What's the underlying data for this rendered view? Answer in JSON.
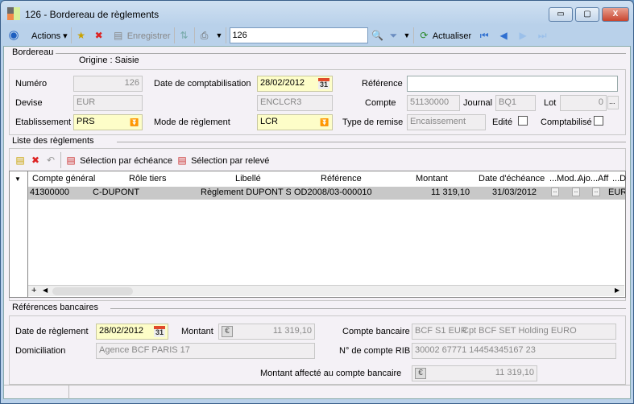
{
  "window": {
    "title": "126 -  Bordereau de règlements",
    "minimize": "▭",
    "maximize": "▢",
    "close": "X"
  },
  "toolbar": {
    "actions": "Actions",
    "save": "Enregistrer",
    "search_value": "126",
    "refresh": "Actualiser"
  },
  "bordereau": {
    "section": "Bordereau",
    "origine": "Origine : Saisie",
    "numero_label": "Numéro",
    "numero": "126",
    "date_compta_label": "Date de comptabilisation",
    "date_compta": "28/02/2012",
    "reference_label": "Référence",
    "reference": "",
    "devise_label": "Devise",
    "devise": "EUR",
    "code": "ENCLCR3",
    "compte_label": "Compte",
    "compte": "51130000",
    "journal_label": "Journal",
    "journal": "BQ1",
    "lot_label": "Lot",
    "lot": "0",
    "etab_label": "Etablissement",
    "etab": "PRS",
    "mode_label": "Mode de règlement",
    "mode": "LCR",
    "type_remise_label": "Type de remise",
    "type_remise": "Encaissement",
    "edite_label": "Edité",
    "compta_label": "Comptabilisé"
  },
  "liste": {
    "section": "Liste des règlements",
    "sel_echeance": "Sélection par échéance",
    "sel_releve": "Sélection par relevé",
    "columns": [
      "Compte général",
      "Rôle tiers",
      "Libellé",
      "Référence",
      "Montant",
      "Date d'échéance",
      "...Mod...",
      "Ajo...",
      "Aff",
      "...D"
    ],
    "rows": [
      {
        "compte": "41300000",
        "role": "C-DUPONT",
        "libelle": "Règlement DUPONT SA",
        "reference": "OD2008/03-000010",
        "montant": "11 319,10",
        "date": "31/03/2012",
        "dev": "EUR"
      }
    ],
    "add": "+"
  },
  "banque": {
    "section": "Références bancaires",
    "date_label": "Date de règlement",
    "date": "28/02/2012",
    "montant_label": "Montant",
    "montant": "11 319,10",
    "compte_label": "Compte bancaire",
    "compte_code": "BCF S1 EUR",
    "compte_nom": "Cpt BCF SET Holding EURO",
    "domic_label": "Domiciliation",
    "domic": "Agence BCF PARIS 17",
    "rib_label": "N° de compte RIB",
    "rib": "30002 67771 14454345167 23",
    "affecte_label": "Montant affecté au compte bancaire",
    "affecte": "11 319,10"
  }
}
